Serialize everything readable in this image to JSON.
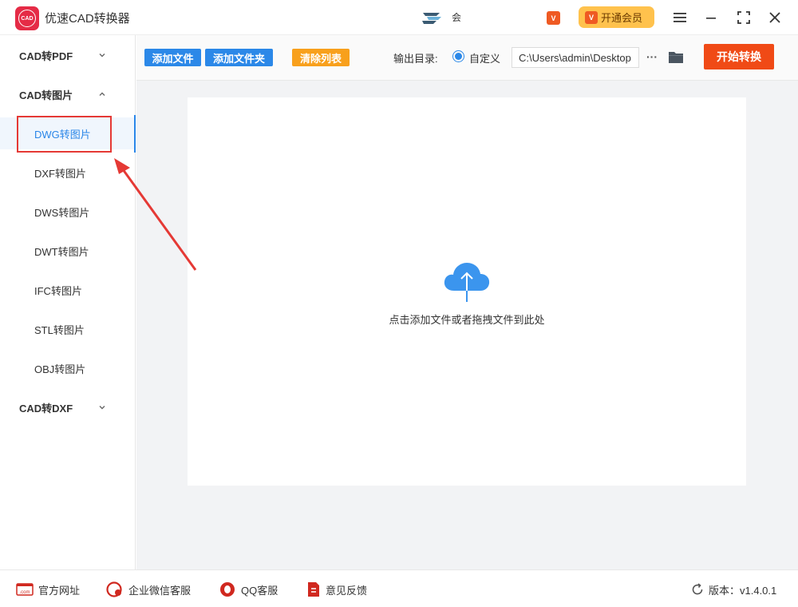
{
  "titlebar": {
    "logo_text": "CAD",
    "app_title": "优速CAD转换器",
    "user_name": "会",
    "vip_small": "V",
    "vip_button_icon": "V",
    "vip_button_label": "开通会员"
  },
  "sidebar": {
    "groups": [
      {
        "label": "CAD转PDF",
        "expanded": false
      },
      {
        "label": "CAD转图片",
        "expanded": true
      },
      {
        "label": "CAD转DXF",
        "expanded": false
      }
    ],
    "subitems": [
      {
        "label": "DWG转图片",
        "active": true
      },
      {
        "label": "DXF转图片",
        "active": false
      },
      {
        "label": "DWS转图片",
        "active": false
      },
      {
        "label": "DWT转图片",
        "active": false
      },
      {
        "label": "IFC转图片",
        "active": false
      },
      {
        "label": "STL转图片",
        "active": false
      },
      {
        "label": "OBJ转图片",
        "active": false
      }
    ]
  },
  "toolbar": {
    "add_file": "添加文件",
    "add_folder": "添加文件夹",
    "clear_list": "清除列表",
    "output_label": "输出目录:",
    "custom_option": "自定义",
    "output_path": "C:\\Users\\admin\\Desktop",
    "more": "···",
    "start": "开始转换"
  },
  "main": {
    "drop_hint": "点击添加文件或者拖拽文件到此处"
  },
  "footer": {
    "website": "官方网址",
    "wechat": "企业微信客服",
    "qq": "QQ客服",
    "feedback": "意见反馈",
    "version": "版本：v1.4.0.1"
  },
  "colors": {
    "accent_blue": "#2b88e8",
    "orange": "#f8a01c",
    "start_red": "#f04a16",
    "vip_yellow": "#ffc24d",
    "brand_red": "#e52b46",
    "annotation_red": "#e53935"
  }
}
